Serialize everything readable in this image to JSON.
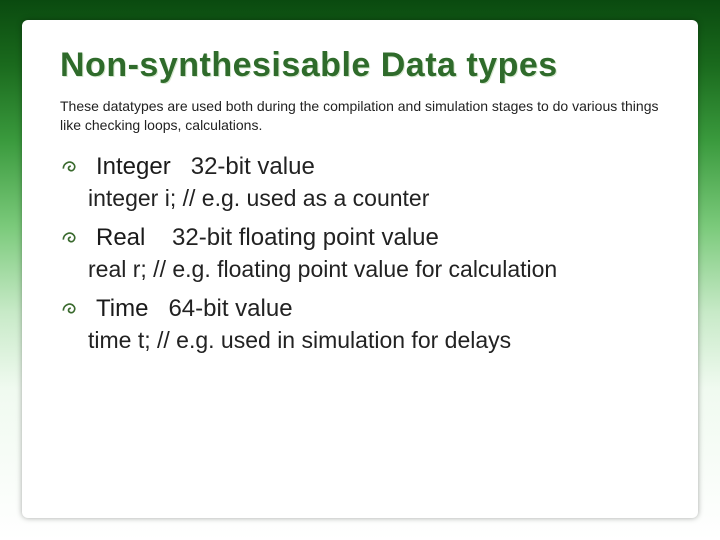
{
  "title": "Non-synthesisable Data types",
  "subtitle": "These datatypes are used both during the compilation and simulation stages to do various things like checking loops, calculations.",
  "items": [
    {
      "keyword": "Integer",
      "desc": "   32-bit value",
      "example": "integer i;  // e.g. used as a counter"
    },
    {
      "keyword": "Real",
      "desc": "    32-bit floating point value",
      "example": "real r;  // e.g. floating point value for calculation"
    },
    {
      "keyword": "Time",
      "desc": "   64-bit value",
      "example": "time t;   // e.g. used in simulation for delays"
    }
  ]
}
